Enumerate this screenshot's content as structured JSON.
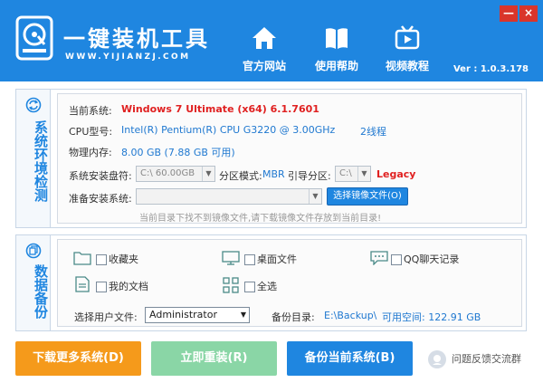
{
  "header": {
    "app_title": "一键装机工具",
    "app_site": "WWW.YIJIANZJ.COM",
    "nav": [
      {
        "label": "官方网站",
        "icon": "home-icon"
      },
      {
        "label": "使用帮助",
        "icon": "book-icon"
      },
      {
        "label": "视频教程",
        "icon": "video-icon"
      }
    ],
    "version": "Ver : 1.0.3.178",
    "minimize": "—",
    "close": "×"
  },
  "system_panel": {
    "title": "系统环境检测",
    "rows": {
      "os_label": "当前系统:",
      "os_value": "Windows 7 Ultimate (x64) 6.1.7601",
      "cpu_label": "CPU型号:",
      "cpu_value": "Intel(R) Pentium(R) CPU G3220 @ 3.00GHz",
      "cpu_threads": "2线程",
      "mem_label": "物理内存:",
      "mem_value": "8.00 GB (7.88 GB 可用)",
      "disk_label": "系统安装盘符:",
      "disk_value": "C:\\    60.00GB",
      "partition_mode_label": "分区模式:",
      "partition_mode_value": "MBR",
      "boot_label": "引导分区:",
      "boot_value": "C:\\",
      "boot_type": "Legacy",
      "prepare_label": "准备安装系统:",
      "prepare_value": "",
      "choose_button": "选择镜像文件(O)",
      "hint": "当前目录下找不到镜像文件,请下载镜像文件存放到当前目录!"
    }
  },
  "backup_panel": {
    "title": "数据备份",
    "items": [
      {
        "label": "收藏夹",
        "icon": "folder-icon"
      },
      {
        "label": "桌面文件",
        "icon": "monitor-icon"
      },
      {
        "label": "QQ聊天记录",
        "icon": "chat-icon"
      },
      {
        "label": "我的文档",
        "icon": "document-icon"
      },
      {
        "label": "全选",
        "icon": "grid-icon"
      }
    ],
    "user_label": "选择用户文件:",
    "user_value": "Administrator",
    "dir_label": "备份目录:",
    "dir_value": "E:\\Backup\\",
    "free_label": "可用空间: 122.91 GB"
  },
  "actions": {
    "download": "下载更多系统(D)",
    "reinstall": "立即重装(R)",
    "backup": "备份当前系统(B)",
    "feedback": "问题反馈交流群"
  },
  "colors": {
    "brand_blue": "#1f86e0",
    "orange": "#f59a1b",
    "green": "#8ad6a6",
    "red_text": "#e02020"
  }
}
